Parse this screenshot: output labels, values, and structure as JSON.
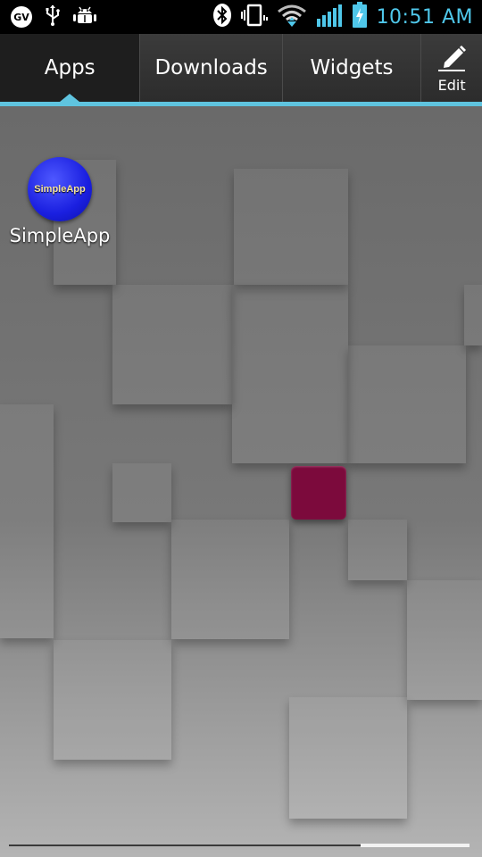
{
  "status_bar": {
    "left_icons": [
      "gv-icon",
      "usb-icon",
      "android-debug-icon"
    ],
    "gv_text": "GV",
    "right_icons": [
      "bluetooth-icon",
      "vibrate-icon",
      "wifi-icon",
      "signal-icon",
      "battery-charging-icon"
    ],
    "time": "10:51 AM",
    "time_color": "#4fc7ea"
  },
  "tabs": [
    {
      "label": "Apps",
      "active": true
    },
    {
      "label": "Downloads",
      "active": false
    },
    {
      "label": "Widgets",
      "active": false
    }
  ],
  "edit": {
    "label": "Edit",
    "icon": "pencil-icon"
  },
  "accent_color": "#5fc4df",
  "apps": [
    {
      "label": "SimpleApp",
      "icon_text": "SimpleApp",
      "icon_color": "#1a1fe0"
    }
  ]
}
